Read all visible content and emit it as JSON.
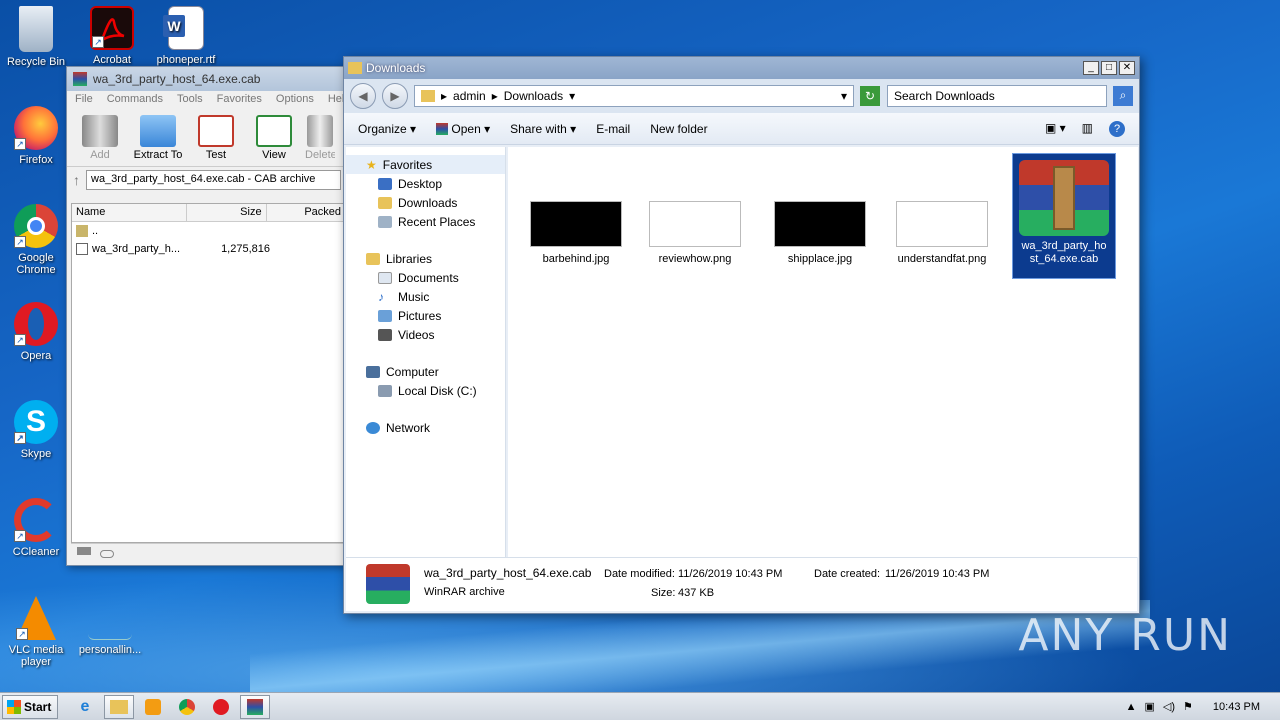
{
  "desktop": {
    "icons": [
      {
        "label": "Recycle Bin",
        "icon": "recycle-bin-icon"
      },
      {
        "label": "Acrobat",
        "icon": "acrobat-icon"
      },
      {
        "label": "phoneper.rtf",
        "icon": "word-document-icon"
      },
      {
        "label": "Firefox",
        "icon": "firefox-icon"
      },
      {
        "label": "Google Chrome",
        "icon": "chrome-icon"
      },
      {
        "label": "Opera",
        "icon": "opera-icon"
      },
      {
        "label": "Skype",
        "icon": "skype-icon"
      },
      {
        "label": "CCleaner",
        "icon": "ccleaner-icon"
      },
      {
        "label": "VLC media player",
        "icon": "vlc-icon"
      },
      {
        "label": "personallin...",
        "icon": "file-icon"
      }
    ]
  },
  "winrar": {
    "title": "wa_3rd_party_host_64.exe.cab",
    "menu": [
      "File",
      "Commands",
      "Tools",
      "Favorites",
      "Options",
      "Help"
    ],
    "toolbar": [
      "Add",
      "Extract To",
      "Test",
      "View",
      "Delete"
    ],
    "path": "wa_3rd_party_host_64.exe.cab - CAB archive",
    "columns": [
      "Name",
      "Size",
      "Packed"
    ],
    "rows": [
      {
        "name": "..",
        "size": ""
      },
      {
        "name": "wa_3rd_party_h...",
        "size": "1,275,816"
      }
    ]
  },
  "explorer": {
    "title": "Downloads",
    "breadcrumb": [
      "admin",
      "Downloads"
    ],
    "search_placeholder": "Search Downloads",
    "commands": [
      "Organize",
      "Open",
      "Share with",
      "E-mail",
      "New folder"
    ],
    "nav": {
      "favorites": {
        "label": "Favorites",
        "items": [
          "Desktop",
          "Downloads",
          "Recent Places"
        ]
      },
      "libraries": {
        "label": "Libraries",
        "items": [
          "Documents",
          "Music",
          "Pictures",
          "Videos"
        ]
      },
      "computer": {
        "label": "Computer",
        "items": [
          "Local Disk (C:)"
        ]
      },
      "network": {
        "label": "Network"
      }
    },
    "files": [
      {
        "name": "barbehind.jpg",
        "thumb": "#000000"
      },
      {
        "name": "reviewhow.png",
        "thumb": "#ffffff"
      },
      {
        "name": "shipplace.jpg",
        "thumb": "#000000"
      },
      {
        "name": "understandfat.png",
        "thumb": "#ffffff"
      },
      {
        "name": "wa_3rd_party_host_64.exe.cab",
        "thumb": "winrar-archive-icon"
      }
    ],
    "details": {
      "filename": "wa_3rd_party_host_64.exe.cab",
      "type": "WinRAR archive",
      "modified_label": "Date modified:",
      "modified": "11/26/2019 10:43 PM",
      "size_label": "Size:",
      "size": "437 KB",
      "created_label": "Date created:",
      "created": "11/26/2019 10:43 PM"
    }
  },
  "taskbar": {
    "start": "Start",
    "clock": "10:43 PM"
  },
  "watermark": "ANY RUN",
  "colors": {
    "accent": "#0c3b8f",
    "desktop": "#1666c6"
  }
}
